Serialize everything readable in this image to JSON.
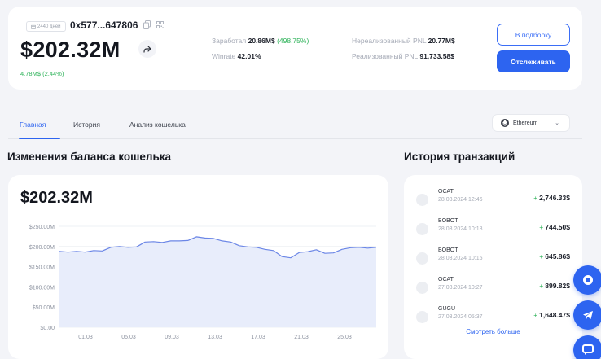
{
  "header": {
    "age_badge": "2440 дней",
    "address": "0x577...647806",
    "balance": "$202.32M",
    "change": "4.78M$ (2.44%)",
    "earned_label": "Заработал",
    "earned_value": "20.86M$",
    "earned_pct": "(498.75%)",
    "winrate_label": "Winrate",
    "winrate_value": "42.01%",
    "unrealized_label": "Нереализованный PNL",
    "unrealized_value": "20.77M$",
    "realized_label": "Реализованный PNL",
    "realized_value": "91,733.58$",
    "btn_collection": "В подборку",
    "btn_track": "Отслеживать"
  },
  "tabs": {
    "main": "Главная",
    "history": "История",
    "analysis": "Анализ кошелька"
  },
  "network": {
    "selected": "Ethereum"
  },
  "balance_section": {
    "title": "Изменения баланса кошелька",
    "value": "$202.32M"
  },
  "chart_data": {
    "type": "area",
    "x": [
      "01.03",
      "05.03",
      "09.03",
      "13.03",
      "17.03",
      "21.03",
      "25.03"
    ],
    "y_ticks": [
      "$250.00M",
      "$200.00M",
      "$150.00M",
      "$100.00M",
      "$50.00M",
      "$0.00"
    ],
    "ylim": [
      0,
      250
    ],
    "series": [
      {
        "values": [
          188,
          186,
          188,
          186,
          190,
          189,
          198,
          200,
          198,
          199,
          211,
          212,
          210,
          214,
          214,
          215,
          224,
          221,
          220,
          214,
          211,
          202,
          199,
          198,
          193,
          190,
          175,
          172,
          185,
          187,
          192,
          183,
          184,
          193,
          197,
          198,
          196,
          198
        ]
      }
    ],
    "color": "#6b86e6",
    "fill": "#e8edfb",
    "grid": true
  },
  "tx_section": {
    "title": "История транзакций",
    "more": "Смотреть больше",
    "rows": [
      {
        "name": "OCAT",
        "date": "28.03.2024 12:46",
        "amount": "2,746.33$"
      },
      {
        "name": "BOBOT",
        "date": "28.03.2024 10:18",
        "amount": "744.50$"
      },
      {
        "name": "BOBOT",
        "date": "28.03.2024 10:15",
        "amount": "645.86$"
      },
      {
        "name": "OCAT",
        "date": "27.03.2024 10:27",
        "amount": "899.82$"
      },
      {
        "name": "GUGU",
        "date": "27.03.2024 05:37",
        "amount": "1,648.47$"
      }
    ],
    "plus": "+"
  },
  "fabs": [
    "whatsapp-icon",
    "telegram-icon",
    "chat-icon"
  ]
}
